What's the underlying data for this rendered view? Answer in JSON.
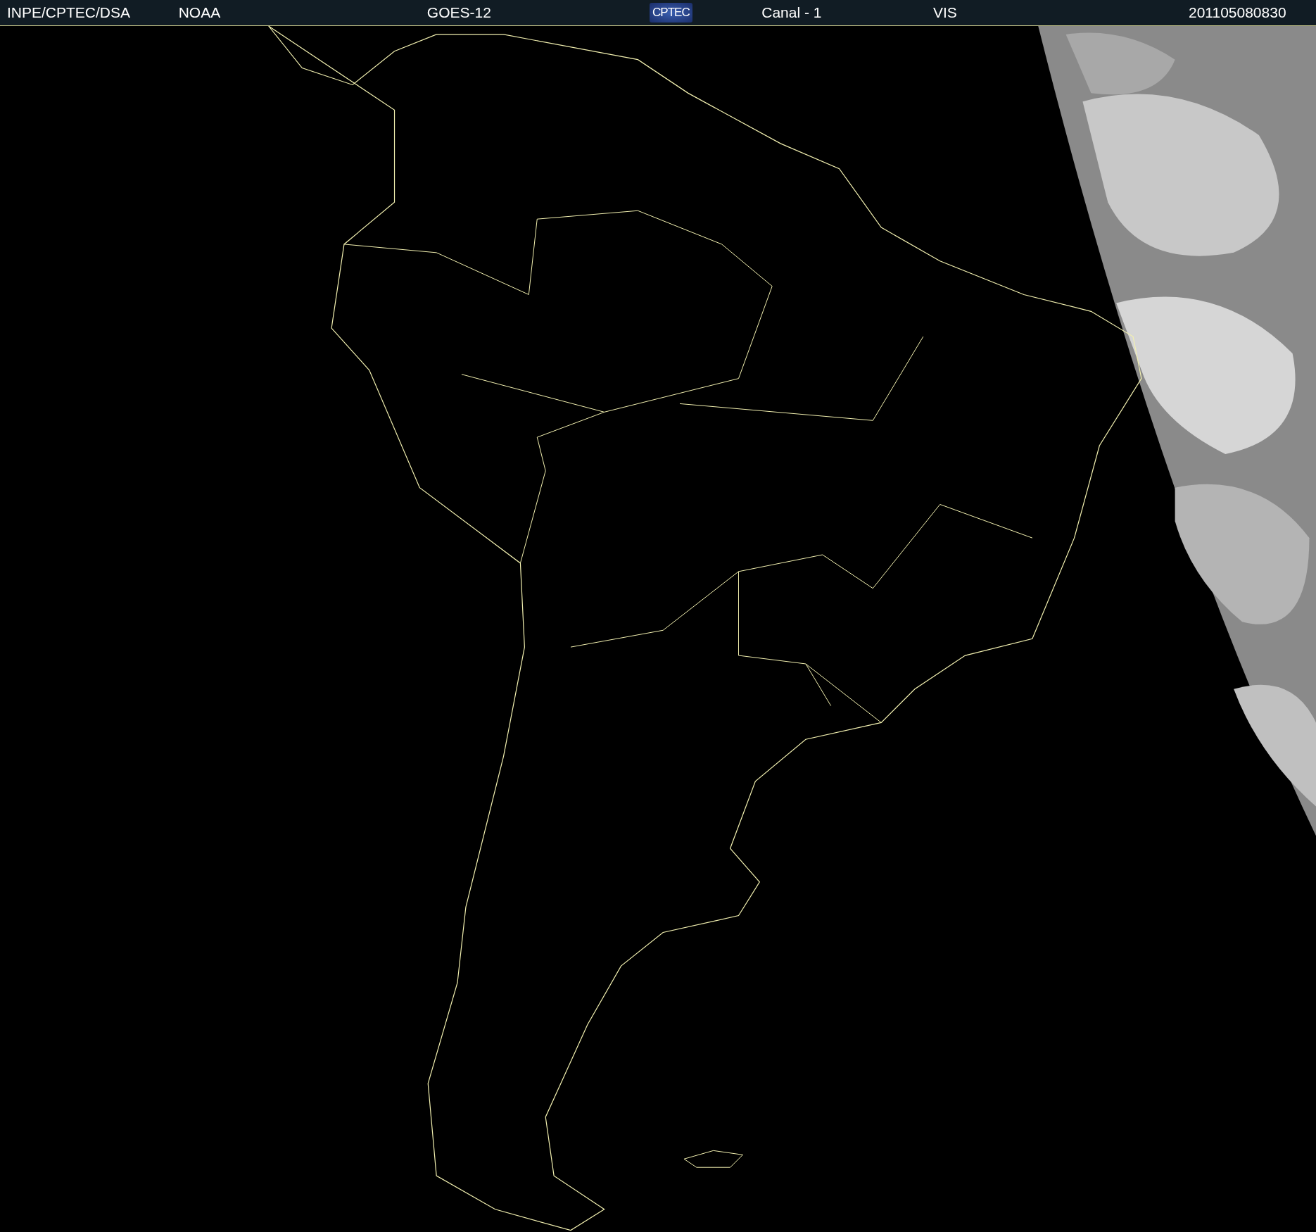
{
  "header": {
    "items": [
      {
        "kind": "text",
        "text": "INPE/CPTEC/DSA"
      },
      {
        "kind": "text",
        "text": "NOAA"
      },
      {
        "kind": "text",
        "text": "GOES-12"
      },
      {
        "kind": "logo",
        "text": "CPTEC"
      },
      {
        "kind": "text",
        "text": "Canal - 1"
      },
      {
        "kind": "text",
        "text": "VIS"
      },
      {
        "kind": "text",
        "text": "201105080830"
      }
    ]
  }
}
